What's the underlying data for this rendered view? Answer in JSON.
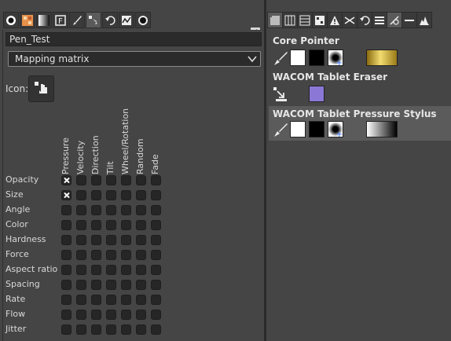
{
  "left_panel": {
    "toolbar_icons": [
      "brush-tip-icon",
      "pattern-icon",
      "gradient-icon",
      "font-icon",
      "paint-brush-icon",
      "dynamics-icon",
      "undo-icon",
      "curve-icon",
      "mypaint-brush-icon"
    ],
    "device_name": "Pen_Test",
    "mode_select_value": "Mapping matrix",
    "icon_label": "Icon:",
    "columns": [
      "Pressure",
      "Velocity",
      "Direction",
      "Tilt",
      "Wheel/Rotation",
      "Random",
      "Fade"
    ],
    "rows": [
      {
        "label": "Opacity",
        "checked": [
          true,
          false,
          false,
          false,
          false,
          false,
          false
        ]
      },
      {
        "label": "Size",
        "checked": [
          true,
          false,
          false,
          false,
          false,
          false,
          false
        ]
      },
      {
        "label": "Angle",
        "checked": [
          false,
          false,
          false,
          false,
          false,
          false,
          false
        ]
      },
      {
        "label": "Color",
        "checked": [
          false,
          false,
          false,
          false,
          false,
          false,
          false
        ]
      },
      {
        "label": "Hardness",
        "checked": [
          false,
          false,
          false,
          false,
          false,
          false,
          false
        ]
      },
      {
        "label": "Force",
        "checked": [
          false,
          false,
          false,
          false,
          false,
          false,
          false
        ]
      },
      {
        "label": "Aspect ratio",
        "checked": [
          false,
          false,
          false,
          false,
          false,
          false,
          false
        ]
      },
      {
        "label": "Spacing",
        "checked": [
          false,
          false,
          false,
          false,
          false,
          false,
          false
        ]
      },
      {
        "label": "Rate",
        "checked": [
          false,
          false,
          false,
          false,
          false,
          false,
          false
        ]
      },
      {
        "label": "Flow",
        "checked": [
          false,
          false,
          false,
          false,
          false,
          false,
          false
        ]
      },
      {
        "label": "Jitter",
        "checked": [
          false,
          false,
          false,
          false,
          false,
          false,
          false
        ]
      }
    ]
  },
  "right_panel": {
    "toolbar_icons": [
      "layers-icon",
      "channels-icon",
      "paths-icon",
      "undo-history-icon",
      "warning-icon",
      "symmetry-icon",
      "redo-icon",
      "stack-icon",
      "dynamics-editor-icon",
      "minus-icon",
      "histogram-icon"
    ],
    "devices": [
      {
        "name": "Core Pointer",
        "tool": "paintbrush-icon",
        "fg": "#ffffff",
        "bg": "#000000",
        "gradient": "gold"
      },
      {
        "name": "WACOM Tablet Eraser",
        "tool": "move-icon",
        "fg": "#8b78d6"
      },
      {
        "name": "WACOM Tablet Pressure Stylus",
        "tool": "paintbrush-icon",
        "fg": "#ffffff",
        "bg": "#000000",
        "gradient": "white-to-black"
      }
    ]
  },
  "colors": {
    "panel_bg": "#454545",
    "checkbox_bg": "#262626",
    "selected_row": "#5b5b5b",
    "eraser_swatch": "#8b78d6"
  }
}
